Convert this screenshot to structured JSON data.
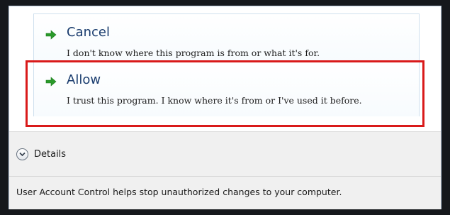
{
  "options": {
    "cancel": {
      "icon": "green-arrow-icon",
      "title": "Cancel",
      "description": "I don't know where this program is from or what it's for."
    },
    "allow": {
      "icon": "green-arrow-icon",
      "title": "Allow",
      "description": "I trust this program. I know where it's from or I've used it before."
    }
  },
  "details": {
    "icon": "chevron-down-circle-icon",
    "label": "Details"
  },
  "footer": {
    "note": "User Account Control helps stop unauthorized changes to your computer."
  },
  "colors": {
    "arrow": "#2a9a2a",
    "title_text": "#1a3c6e",
    "highlight": "#d91a1a",
    "lower_panel": "#f0f0f0"
  }
}
